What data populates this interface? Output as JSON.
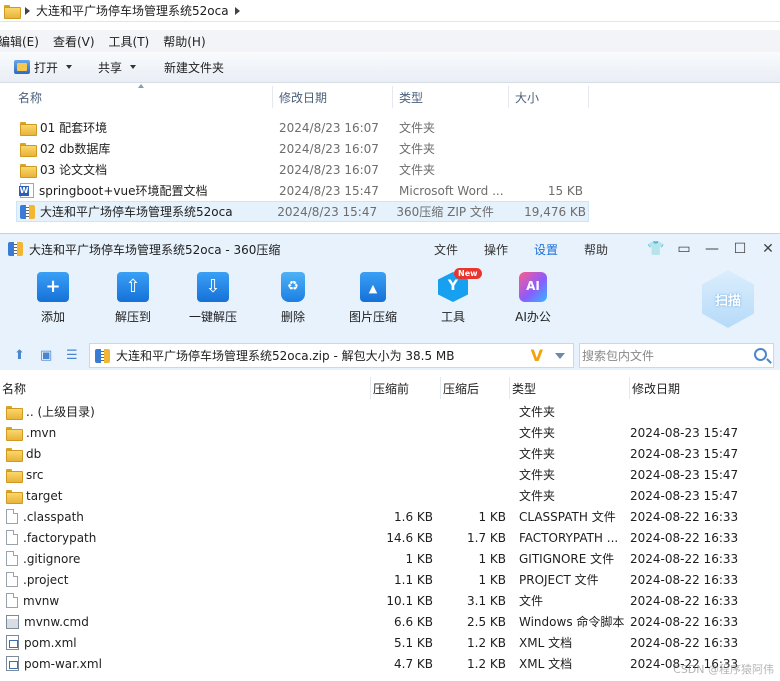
{
  "explorer": {
    "breadcrumb": "大连和平广场停车场管理系统52oca",
    "menu": [
      "编辑(E)",
      "查看(V)",
      "工具(T)",
      "帮助(H)"
    ],
    "toolbar": {
      "open": "打开",
      "share": "共享",
      "new_folder": "新建文件夹"
    },
    "columns": {
      "name": "名称",
      "date": "修改日期",
      "type": "类型",
      "size": "大小"
    },
    "files": [
      {
        "name": "01 配套环境",
        "date": "2024/8/23 16:07",
        "type": "文件夹",
        "size": "",
        "icon": "folder-icon"
      },
      {
        "name": "02 db数据库",
        "date": "2024/8/23 16:07",
        "type": "文件夹",
        "size": "",
        "icon": "folder-icon"
      },
      {
        "name": "03 论文文档",
        "date": "2024/8/23 16:07",
        "type": "文件夹",
        "size": "",
        "icon": "folder-icon"
      },
      {
        "name": "springboot+vue环境配置文档",
        "date": "2024/8/23 15:47",
        "type": "Microsoft Word ...",
        "size": "15 KB",
        "icon": "word-icon"
      },
      {
        "name": "大连和平广场停车场管理系统52oca",
        "date": "2024/8/23 15:47",
        "type": "360压缩 ZIP 文件",
        "size": "19,476 KB",
        "icon": "zip-icon"
      }
    ]
  },
  "zip": {
    "title": "大连和平广场停车场管理系统52oca - 360压缩",
    "menu": [
      "文件",
      "操作",
      "设置",
      "帮助"
    ],
    "tools": {
      "add": "添加",
      "extract_to": "解压到",
      "one_click": "一键解压",
      "delete": "删除",
      "img_compress": "图片压缩",
      "tools": "工具",
      "tools_badge": "New",
      "ai_office": "AI办公",
      "scan": "扫描"
    },
    "path": "大连和平广场停车场管理系统52oca.zip - 解包大小为 38.5 MB",
    "search_placeholder": "搜索包内文件",
    "columns": {
      "name": "名称",
      "csize": "压缩前",
      "size": "压缩后",
      "type": "类型",
      "date": "修改日期"
    },
    "rows": [
      {
        "name": ".. (上级目录)",
        "csize": "",
        "size": "",
        "type": "文件夹",
        "date": "",
        "icon": "folder-icon"
      },
      {
        "name": ".mvn",
        "csize": "",
        "size": "",
        "type": "文件夹",
        "date": "2024-08-23 15:47",
        "icon": "folder-icon"
      },
      {
        "name": "db",
        "csize": "",
        "size": "",
        "type": "文件夹",
        "date": "2024-08-23 15:47",
        "icon": "folder-icon"
      },
      {
        "name": "src",
        "csize": "",
        "size": "",
        "type": "文件夹",
        "date": "2024-08-23 15:47",
        "icon": "folder-icon"
      },
      {
        "name": "target",
        "csize": "",
        "size": "",
        "type": "文件夹",
        "date": "2024-08-23 15:47",
        "icon": "folder-icon"
      },
      {
        "name": ".classpath",
        "csize": "1.6 KB",
        "size": "1 KB",
        "type": "CLASSPATH 文件",
        "date": "2024-08-22 16:33",
        "icon": "file-icon"
      },
      {
        "name": ".factorypath",
        "csize": "14.6 KB",
        "size": "1.7 KB",
        "type": "FACTORYPATH ...",
        "date": "2024-08-22 16:33",
        "icon": "file-icon"
      },
      {
        "name": ".gitignore",
        "csize": "1 KB",
        "size": "1 KB",
        "type": "GITIGNORE 文件",
        "date": "2024-08-22 16:33",
        "icon": "file-icon"
      },
      {
        "name": ".project",
        "csize": "1.1 KB",
        "size": "1 KB",
        "type": "PROJECT 文件",
        "date": "2024-08-22 16:33",
        "icon": "file-icon"
      },
      {
        "name": "mvnw",
        "csize": "10.1 KB",
        "size": "3.1 KB",
        "type": "文件",
        "date": "2024-08-22 16:33",
        "icon": "file-icon"
      },
      {
        "name": "mvnw.cmd",
        "csize": "6.6 KB",
        "size": "2.5 KB",
        "type": "Windows 命令脚本",
        "date": "2024-08-22 16:33",
        "icon": "cmd-icon"
      },
      {
        "name": "pom.xml",
        "csize": "5.1 KB",
        "size": "1.2 KB",
        "type": "XML 文档",
        "date": "2024-08-22 16:33",
        "icon": "xml-icon"
      },
      {
        "name": "pom-war.xml",
        "csize": "4.7 KB",
        "size": "1.2 KB",
        "type": "XML 文档",
        "date": "2024-08-22 16:33",
        "icon": "xml-icon"
      }
    ]
  },
  "watermark": "CSDN @程序猿阿伟"
}
